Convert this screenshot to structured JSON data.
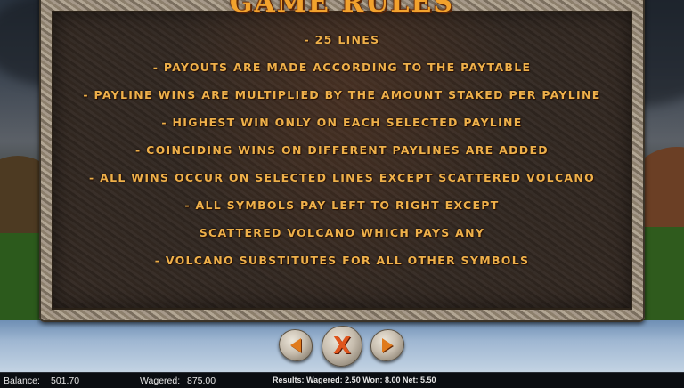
{
  "title": "GAME RULES",
  "rules": [
    "- 25 LINES",
    "- PAYOUTS ARE MADE ACCORDING TO THE PAYTABLE",
    "- PAYLINE WINS ARE MULTIPLIED BY THE AMOUNT STAKED PER PAYLINE",
    "- HIGHEST WIN ONLY ON EACH SELECTED PAYLINE",
    "- COINCIDING WINS ON DIFFERENT PAYLINES ARE ADDED",
    "- ALL WINS OCCUR ON SELECTED LINES EXCEPT SCATTERED VOLCANO",
    "- ALL SYMBOLS PAY LEFT TO RIGHT EXCEPT",
    "SCATTERED VOLCANO WHICH PAYS ANY",
    "- VOLCANO SUBSTITUTES FOR ALL OTHER SYMBOLS"
  ],
  "nav": {
    "prev_icon": "arrow-left-icon",
    "close_label": "X",
    "next_icon": "arrow-right-icon"
  },
  "status": {
    "balance_label": "Balance:",
    "balance_value": "501.70",
    "wagered_label": "Wagered:",
    "wagered_value": "875.00",
    "results": "Results:  Wagered: 2.50  Won: 8.00  Net: 5.50"
  },
  "colors": {
    "title": "#f2a22d",
    "rule_text": "#eeb04a",
    "nav_accent": "#e07a1c"
  }
}
